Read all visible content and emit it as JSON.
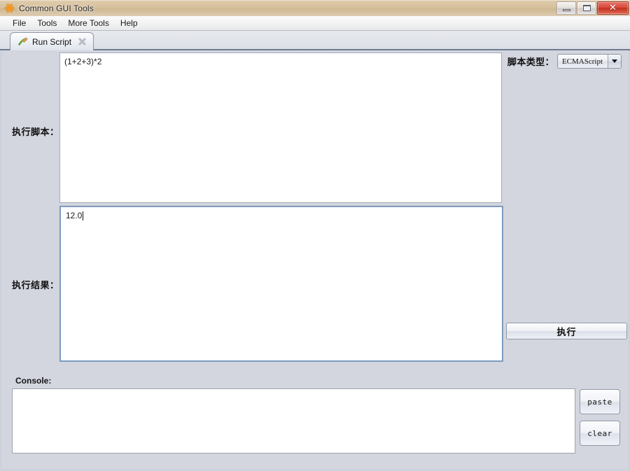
{
  "window": {
    "title": "Common GUI Tools",
    "icon": "sparkle-icon",
    "buttons": {
      "minimize": "minimize-icon",
      "maximize": "maximize-icon",
      "close": "✕"
    }
  },
  "menubar": {
    "items": [
      {
        "label": "File"
      },
      {
        "label": "Tools"
      },
      {
        "label": "More Tools"
      },
      {
        "label": "Help"
      }
    ]
  },
  "tabs": [
    {
      "label": "Run Script",
      "icon": "script-pencil-icon",
      "close_icon": "close-icon",
      "active": true
    }
  ],
  "main": {
    "script_label": "执行脚本：",
    "script_value": "(1+2+3)*2",
    "script_placeholder": "",
    "result_label": "执行结果：",
    "result_value": "12.0",
    "script_type_label": "脚本类型：",
    "script_type_selected": "ECMAScript",
    "script_type_options": [
      "ECMAScript"
    ],
    "execute_label": "执行"
  },
  "console": {
    "label": "Console:",
    "value": "",
    "placeholder": "",
    "paste_label": "paste",
    "clear_label": "clear"
  },
  "colors": {
    "panel_bg": "#d3d6df",
    "titlebar_glass": "#d6c09c",
    "focus_border": "#7d9bbd",
    "tab_underline": "#6e7b90",
    "close_button": "#c2301f"
  }
}
